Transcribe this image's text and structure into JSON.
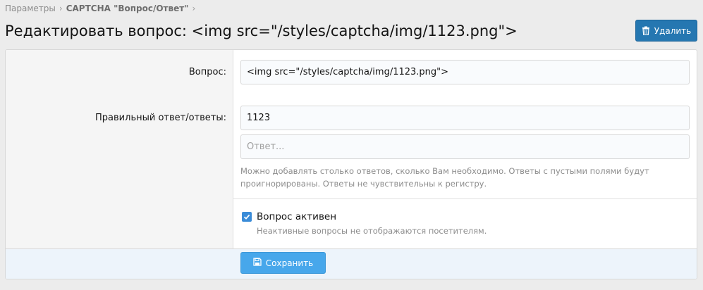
{
  "breadcrumb": {
    "items": [
      "Параметры",
      "CAPTCHA \"Вопрос/Ответ\""
    ],
    "separator": "›"
  },
  "page_title": "Редактировать вопрос: <img src=\"/styles/captcha/img/1123.png\">",
  "header": {
    "delete_label": "Удалить",
    "delete_icon": "trash-icon"
  },
  "form": {
    "question_label": "Вопрос:",
    "question_value": "<img src=\"/styles/captcha/img/1123.png\">",
    "answers_label": "Правильный ответ/ответы:",
    "answers": [
      "1123"
    ],
    "answer_placeholder": "Ответ...",
    "answers_hint_line1": "Можно добавлять столько ответов, сколько Вам необходимо. Ответы с пустыми полями будут",
    "answers_hint_line2": "проигнорированы. Ответы не чувствительны к регистру.",
    "active_label": "Вопрос активен",
    "active_checked": true,
    "active_hint": "Неактивные вопросы не отображаются посетителям."
  },
  "footer": {
    "save_label": "Сохранить",
    "save_icon": "save-icon"
  },
  "colors": {
    "primary": "#2577b1",
    "save": "#47a7eb",
    "checkbox": "#3b8cd8"
  }
}
